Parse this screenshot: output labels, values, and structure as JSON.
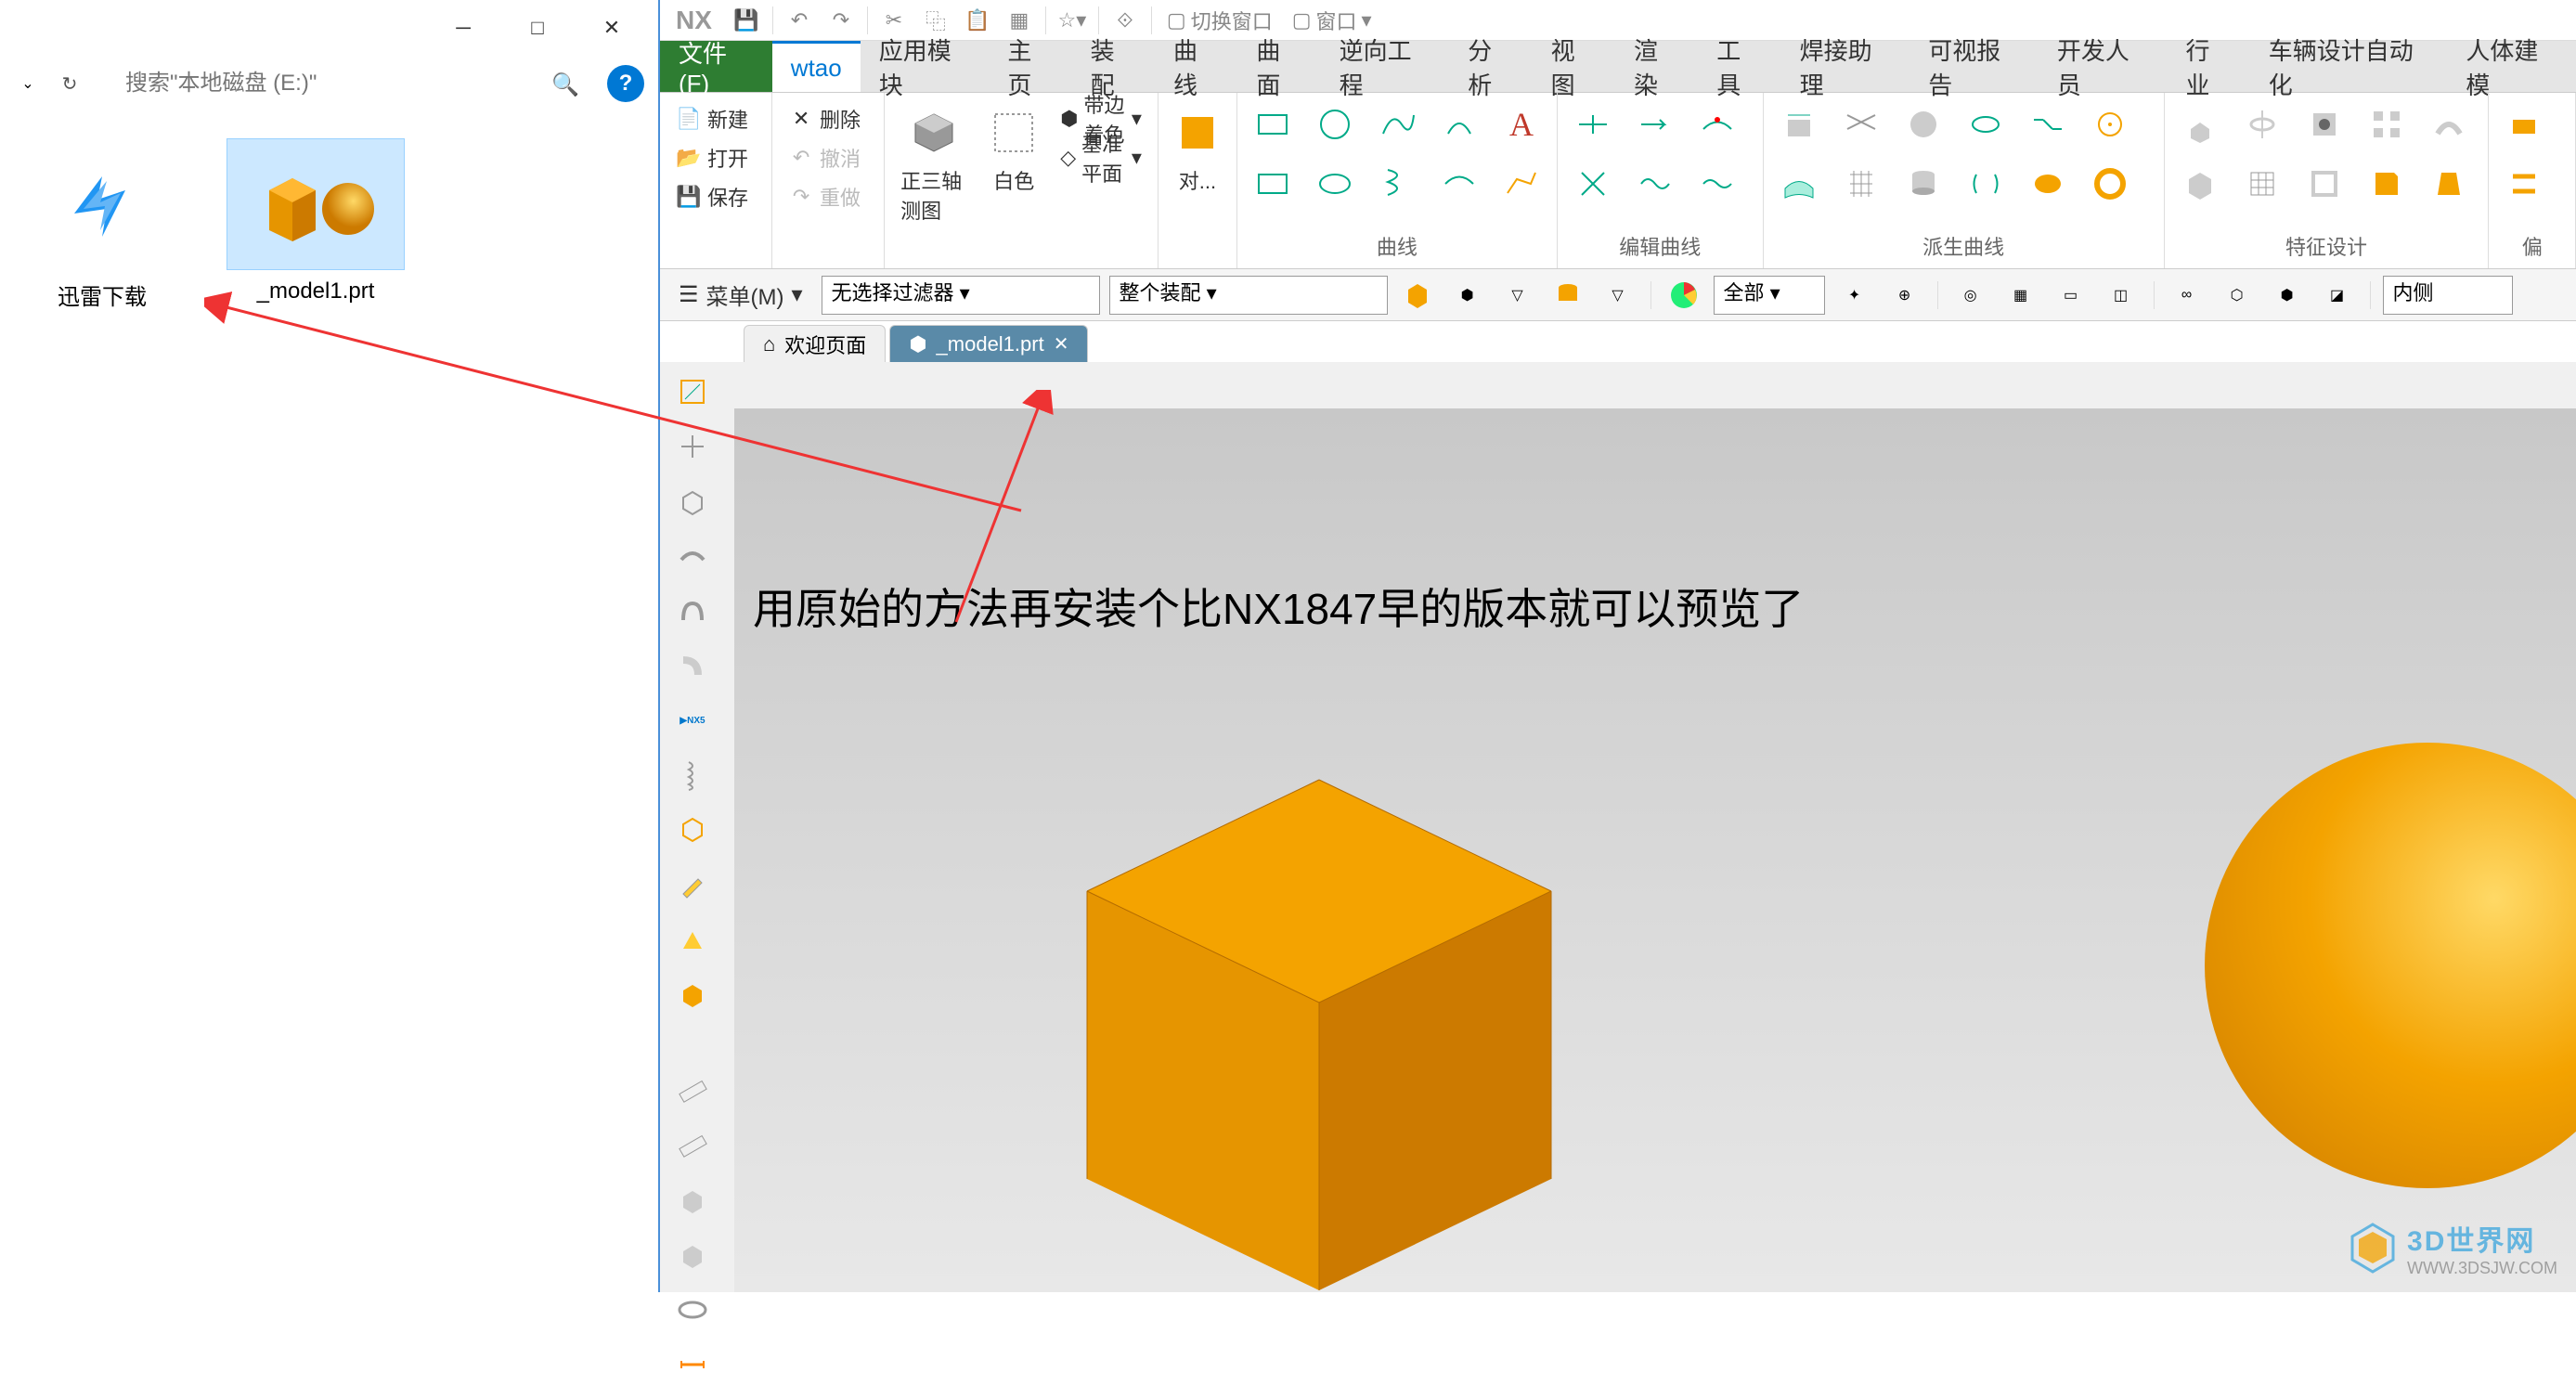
{
  "explorer": {
    "search_placeholder": "搜索\"本地磁盘 (E:)\"",
    "files": [
      {
        "name": "迅雷下载"
      },
      {
        "name": "_model1.prt"
      }
    ]
  },
  "nx": {
    "logo": "NX",
    "titlebar": {
      "switch_window": "切换窗口",
      "window": "窗口"
    },
    "menus": {
      "file": "文件(F)",
      "wtao": "wtao",
      "app_module": "应用模块",
      "home": "主页",
      "assembly": "装配",
      "curve": "曲线",
      "surface": "曲面",
      "reverse": "逆向工程",
      "analysis": "分析",
      "view": "视图",
      "render": "渲染",
      "tool": "工具",
      "weld": "焊接助理",
      "visual_report": "可视报告",
      "developer": "开发人员",
      "industry": "行业",
      "vehicle": "车辆设计自动化",
      "body_model": "人体建模"
    },
    "ribbon": {
      "new": "新建",
      "open": "打开",
      "save": "保存",
      "delete": "删除",
      "undo": "撤消",
      "redo": "重做",
      "trimetric": "正三轴测图",
      "white": "白色",
      "shade_edge": "带边着色",
      "datum_plane": "基准平面",
      "object": "对...",
      "curve_grp": "曲线",
      "edit_curve": "编辑曲线",
      "derived_curve": "派生曲线",
      "feature_design": "特征设计",
      "offset": "偏"
    },
    "toolbar": {
      "menu": "菜单(M)",
      "no_filter": "无选择过滤器",
      "whole_assembly": "整个装配",
      "all": "全部",
      "inside": "内侧"
    },
    "tabs": {
      "welcome": "欢迎页面",
      "model": "_model1.prt"
    },
    "viewport_text": "用原始的方法再安装个比NX1847早的版本就可以预览了"
  },
  "watermark": {
    "title": "3D世界网",
    "url": "WWW.3DSJW.COM"
  }
}
